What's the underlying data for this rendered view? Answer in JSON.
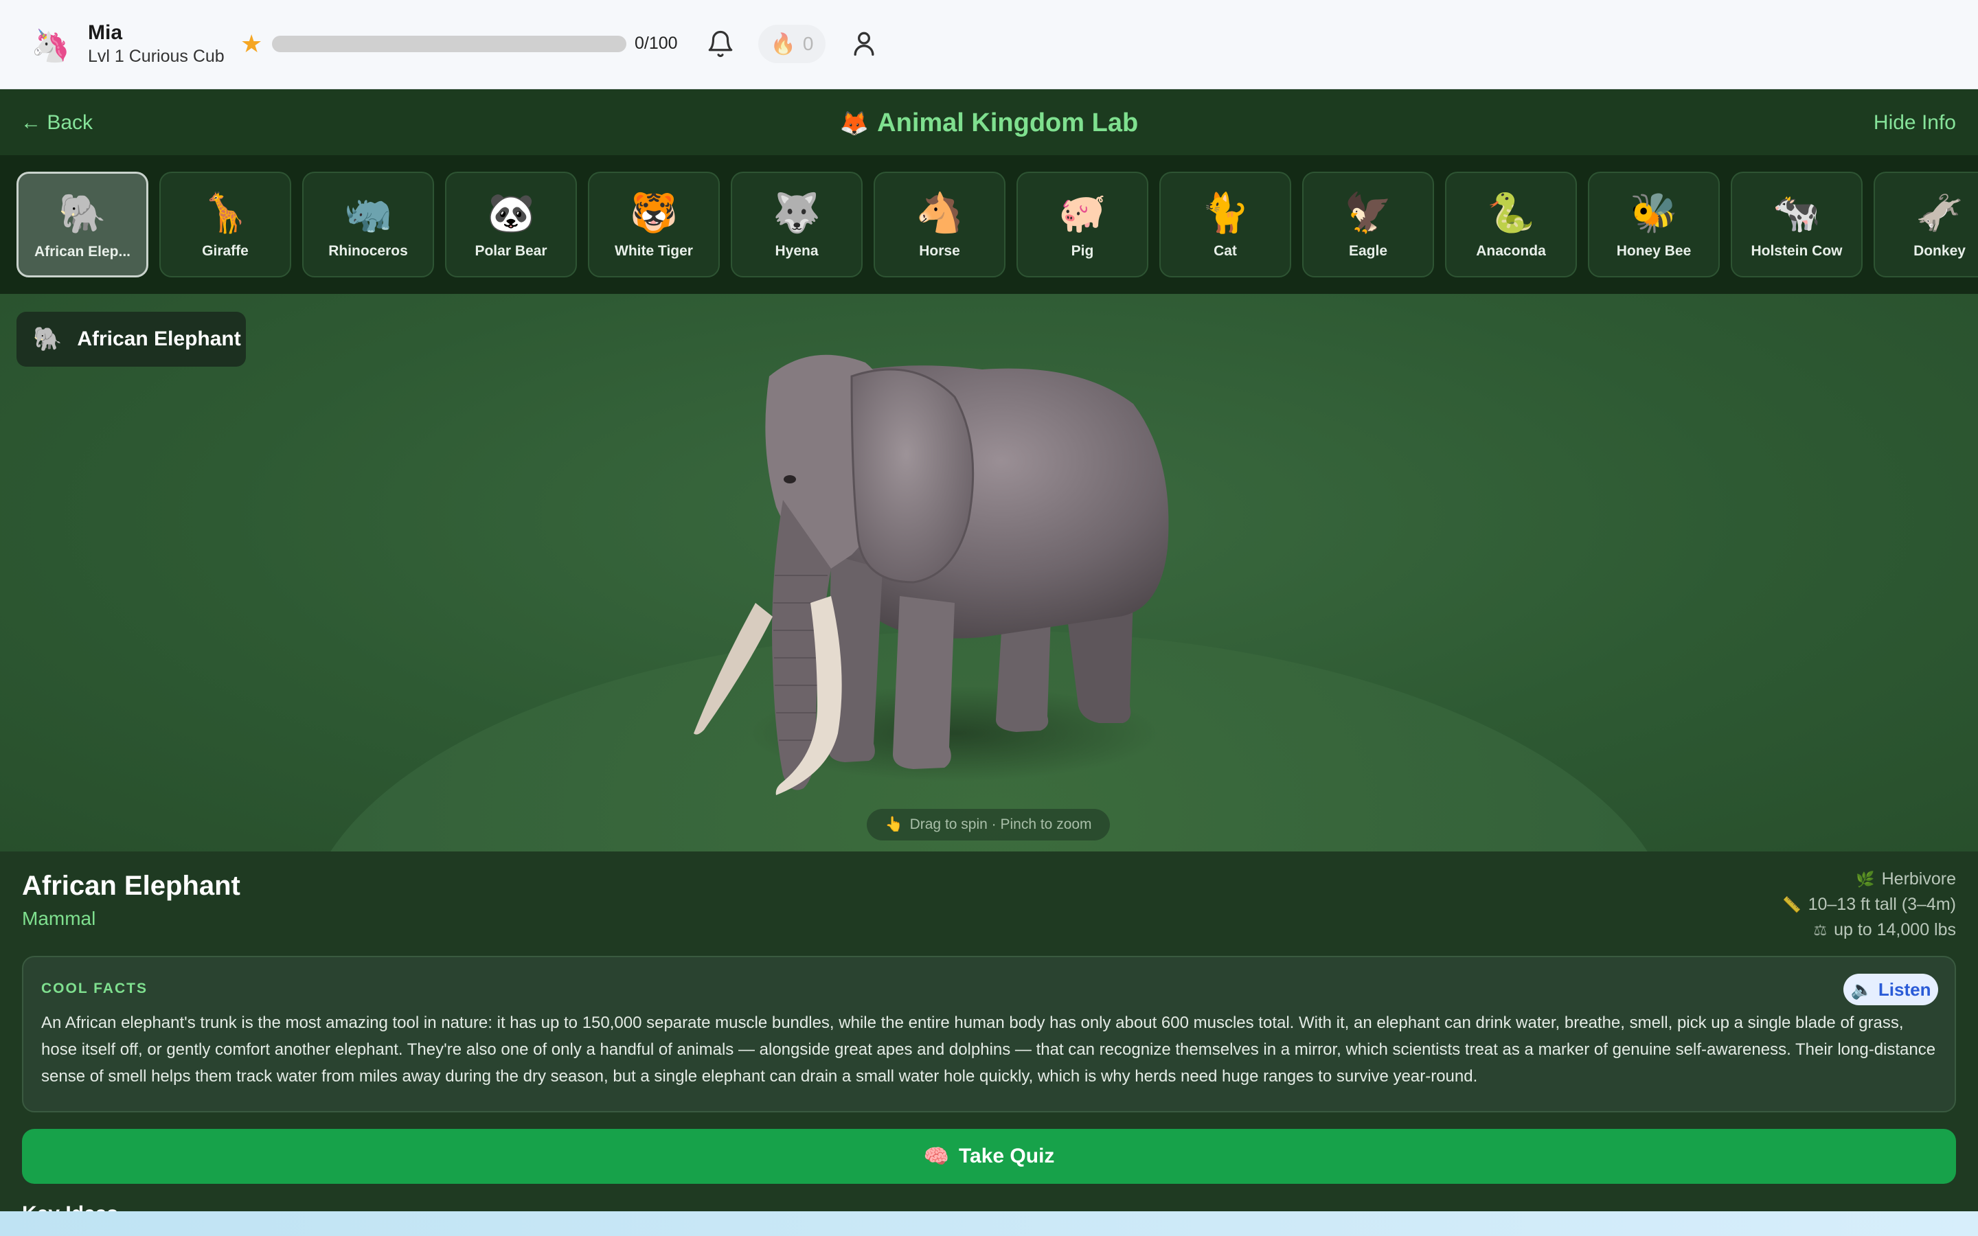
{
  "user": {
    "name": "Mia",
    "level": "Lvl 1 Curious Cub",
    "avatar_icon": "unicorn-icon"
  },
  "xp": {
    "current": 0,
    "max": 100,
    "text": "0/100"
  },
  "streak": {
    "count": "0"
  },
  "lab": {
    "back_label": "Back",
    "title": "Animal Kingdom Lab",
    "title_icon": "🦊",
    "hide_info_label": "Hide Info"
  },
  "animals": [
    {
      "emoji": "🐘",
      "label": "African Elep...",
      "active": true
    },
    {
      "emoji": "🦒",
      "label": "Giraffe"
    },
    {
      "emoji": "🦏",
      "label": "Rhinoceros"
    },
    {
      "emoji": "🐼",
      "label": "Polar Bear"
    },
    {
      "emoji": "🐯",
      "label": "White Tiger"
    },
    {
      "emoji": "🐺",
      "label": "Hyena"
    },
    {
      "emoji": "🐴",
      "label": "Horse"
    },
    {
      "emoji": "🐖",
      "label": "Pig"
    },
    {
      "emoji": "🐈",
      "label": "Cat"
    },
    {
      "emoji": "🦅",
      "label": "Eagle"
    },
    {
      "emoji": "🐍",
      "label": "Anaconda"
    },
    {
      "emoji": "🐝",
      "label": "Honey Bee"
    },
    {
      "emoji": "🐄",
      "label": "Holstein Cow"
    },
    {
      "emoji": "🫏",
      "label": "Donkey"
    }
  ],
  "viewer": {
    "badge_emoji": "🐘",
    "badge_label": "African Elephant",
    "hint": "Drag to spin · Pinch to zoom"
  },
  "info": {
    "name": "African Elephant",
    "class": "Mammal",
    "diet": "Herbivore",
    "height": "10–13 ft tall (3–4m)",
    "weight": "up to 14,000 lbs",
    "facts_title": "COOL FACTS",
    "listen_label": "Listen",
    "facts_text": "An African elephant's trunk is the most amazing tool in nature: it has up to 150,000 separate muscle bundles, while the entire human body has only about 600 muscles total. With it, an elephant can drink water, breathe, smell, pick up a single blade of grass, hose itself off, or gently comfort another elephant. They're also one of only a handful of animals — alongside great apes and dolphins — that can recognize themselves in a mirror, which scientists treat as a marker of genuine self-awareness. Their long-distance sense of smell helps them track water from miles away during the dry season, but a single elephant can drain a small water hole quickly, which is why herds need huge ranges to survive year-round.",
    "quiz_label": "Take Quiz",
    "key_ideas_label": "Key Ideas"
  },
  "colors": {
    "accent_green": "#7fe08f",
    "quiz_green": "#17a24a",
    "star": "#f5a623"
  }
}
